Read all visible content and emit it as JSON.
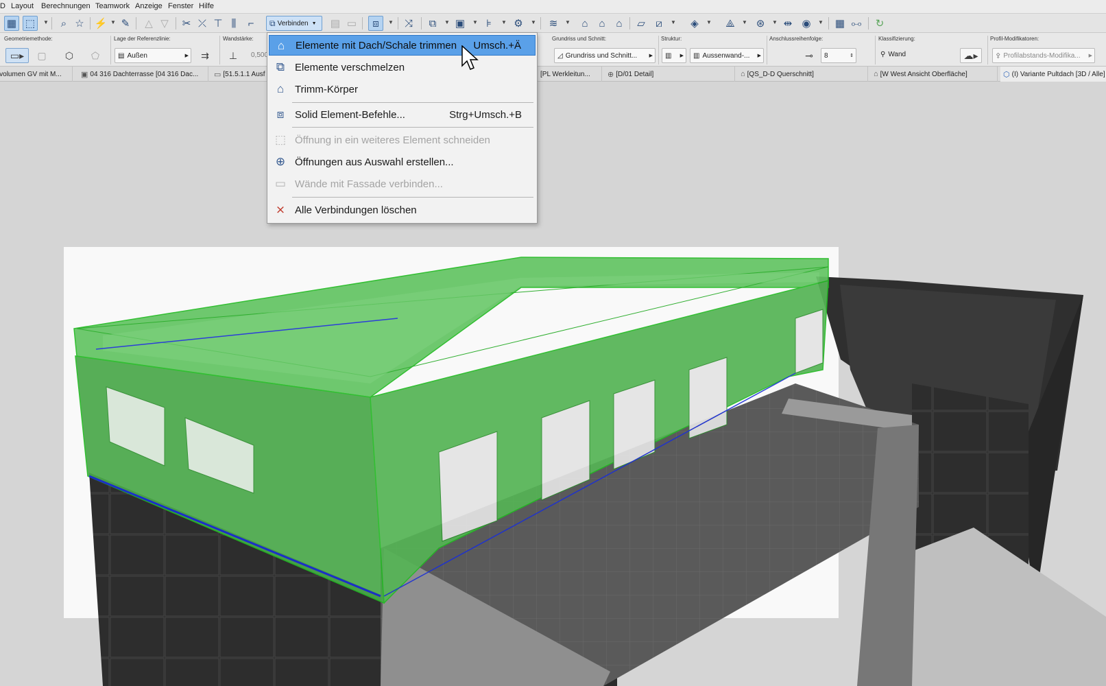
{
  "menubar": {
    "first_fragment": "D",
    "items": [
      "Layout",
      "Berechnungen",
      "Teamwork",
      "Anzeige",
      "Fenster",
      "Hilfe"
    ]
  },
  "toolbar": {
    "verbinden_label": "Verbinden"
  },
  "infobox": {
    "geometry_label": "Geometriemethode:",
    "reference_label": "Lage der Referenzlinie:",
    "reference_value": "Außen",
    "thickness_label": "Wandstärke:",
    "thickness_value": "0,500",
    "section_label": "Grundriss und Schnitt:",
    "section_value": "Grundriss und Schnitt...",
    "structure_label": "Struktur:",
    "structure_value": "Aussenwand-...",
    "priority_label": "Anschlussreihenfolge:",
    "priority_value": "8",
    "class_label": "Klassifizierung:",
    "class_value": "Wand",
    "profile_label": "Profil-Modifikatoren:",
    "profile_value": "Profilabstands-Modifika..."
  },
  "tabs": [
    {
      "label": "Gebäudevolumen GV mit M..."
    },
    {
      "label": "04 316 Dachterrasse [04 316 Dac..."
    },
    {
      "label": "[51.5.1.1 Ausf"
    },
    {
      "label": "[PL Werkleitun..."
    },
    {
      "label": "[D/01 Detail]"
    },
    {
      "label": "[QS_D-D Querschnitt]"
    },
    {
      "label": "[W West Ansicht Oberfläche]"
    },
    {
      "label": "(I) Variante Pultdach [3D / Alle]"
    }
  ],
  "dropdown": {
    "items": [
      {
        "label": "Elemente mit Dach/Schale trimmen",
        "shortcut": "Umsch.+Ä",
        "icon": "roof-trim-icon",
        "state": "highlighted"
      },
      {
        "label": "Elemente verschmelzen",
        "shortcut": "",
        "icon": "merge-elements-icon",
        "state": "enabled"
      },
      {
        "label": "Trimm-Körper",
        "shortcut": "",
        "icon": "trim-body-icon",
        "state": "enabled"
      },
      {
        "label": "Solid Element-Befehle...",
        "shortcut": "Strg+Umsch.+B",
        "icon": "solid-element-icon",
        "state": "enabled"
      },
      {
        "label": "Öffnung in ein weiteres Element schneiden",
        "shortcut": "",
        "icon": "cut-opening-icon",
        "state": "disabled"
      },
      {
        "label": "Öffnungen aus Auswahl erstellen...",
        "shortcut": "",
        "icon": "create-openings-icon",
        "state": "enabled"
      },
      {
        "label": "Wände mit Fassade verbinden...",
        "shortcut": "",
        "icon": "wall-facade-icon",
        "state": "disabled"
      },
      {
        "label": "Alle Verbindungen löschen",
        "shortcut": "",
        "icon": "delete-connections-icon",
        "state": "enabled"
      }
    ]
  },
  "colors": {
    "selection_green": "#33cc33",
    "highlight_blue": "#5aa0e8",
    "edge_blue": "#1a2fd6"
  }
}
